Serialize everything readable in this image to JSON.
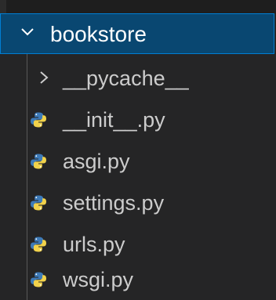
{
  "explorer": {
    "folder": {
      "name": "bookstore",
      "expanded": true,
      "chevron_icon": "chevron-down-icon"
    },
    "items": [
      {
        "name": "__pycache__",
        "type": "folder",
        "icon": "chevron-right-icon"
      },
      {
        "name": "__init__.py",
        "type": "file",
        "icon": "python-icon"
      },
      {
        "name": "asgi.py",
        "type": "file",
        "icon": "python-icon"
      },
      {
        "name": "settings.py",
        "type": "file",
        "icon": "python-icon"
      },
      {
        "name": "urls.py",
        "type": "file",
        "icon": "python-icon"
      },
      {
        "name": "wsgi.py",
        "type": "file",
        "icon": "python-icon"
      }
    ]
  },
  "colors": {
    "background": "#252526",
    "selected_background": "#094771",
    "focus_border": "#007fd4",
    "text": "#cccccc",
    "python_blue": "#3d7ab8",
    "python_yellow": "#f1d24b"
  }
}
